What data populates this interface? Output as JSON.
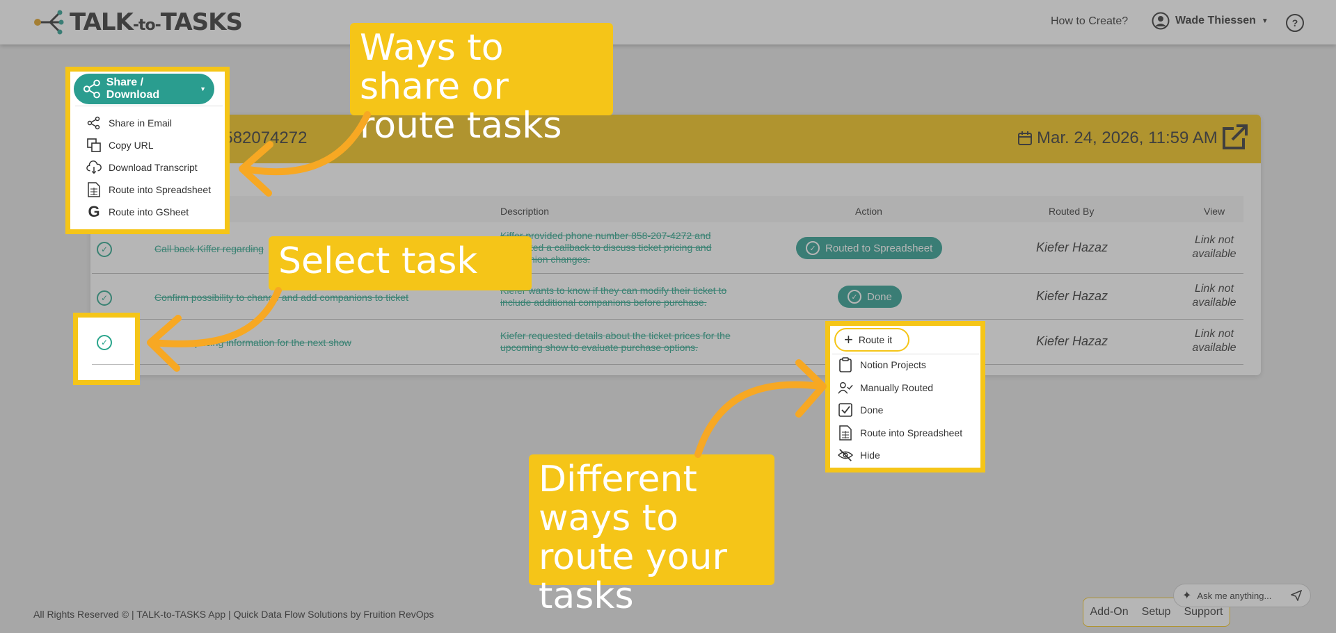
{
  "header": {
    "logo_text_1": "TALK",
    "logo_text_to": "-to-",
    "logo_text_2": "TASKS",
    "how_to": "How to Create?",
    "user_name": "Wade Thiessen",
    "help_glyph": "?"
  },
  "card": {
    "title": "8582074272",
    "date": "Mar. 24, 2026, 11:59 AM"
  },
  "table": {
    "headers": [
      "Description",
      "Action",
      "Routed By",
      "View"
    ],
    "rows": [
      {
        "task": "Call back Kiffer regarding",
        "description": "Kiffer provided phone number 858-207-4272 and requested a callback to discuss ticket pricing and companion changes.",
        "action": "Routed to Spreadsheet",
        "routed_by": "Kiefer Hazaz",
        "view": "Link not available"
      },
      {
        "task": "Confirm possibility to change and add companions to ticket",
        "description": "Kiefer wants to know if they can modify their ticket to include additional companions before purchase.",
        "action": "Done",
        "routed_by": "Kiefer Hazaz",
        "view": "Link not available"
      },
      {
        "task": "pricing information for the next show",
        "description": "Kiefer requested details about the ticket prices for the upcoming show to evaluate purchase options.",
        "action": "Route it",
        "routed_by": "Kiefer Hazaz",
        "view": "Link not available"
      }
    ]
  },
  "share_menu": {
    "button_label": "Share / Download",
    "items": [
      "Share in Email",
      "Copy URL",
      "Download Transcript",
      "Route into Spreadsheet",
      "Route into GSheet"
    ]
  },
  "route_menu": {
    "button_label": "Route it",
    "items": [
      "Notion Projects",
      "Manually Routed",
      "Done",
      "Route into Spreadsheet",
      "Hide"
    ]
  },
  "callouts": {
    "share": "Ways to share or route tasks",
    "select": "Select task",
    "route": "Different ways to route your tasks"
  },
  "footer": {
    "text": "All Rights Reserved © | TALK-to-TASKS App | Quick Data Flow Solutions by Fruition RevOps",
    "links": [
      "Add-On",
      "Setup",
      "Support"
    ],
    "ask_placeholder": "Ask me anything..."
  },
  "colors": {
    "accent_yellow": "#f5c518",
    "teal": "#2a9d8f",
    "strike_green": "#2aa58c"
  }
}
